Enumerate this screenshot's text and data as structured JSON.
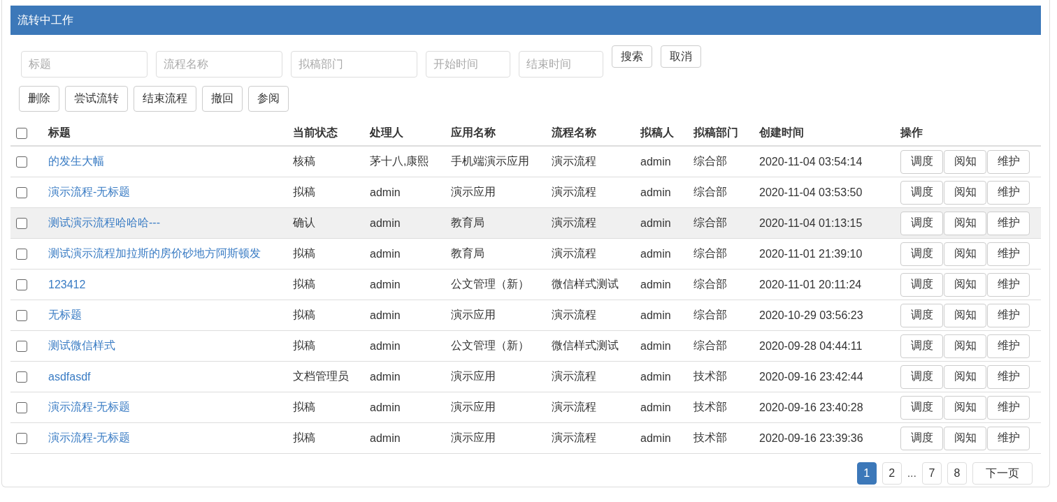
{
  "panel": {
    "title": "流转中工作"
  },
  "filters": [
    {
      "placeholder": "标题"
    },
    {
      "placeholder": "流程名称"
    },
    {
      "placeholder": "拟稿部门"
    },
    {
      "placeholder": "开始时间"
    },
    {
      "placeholder": "结束时间"
    }
  ],
  "filter_buttons": [
    "搜索",
    "取消"
  ],
  "toolbar_buttons": [
    "删除",
    "尝试流转",
    "结束流程",
    "撤回",
    "参阅"
  ],
  "table": {
    "select_all_checked": false,
    "columns": [
      "标题",
      "当前状态",
      "处理人",
      "应用名称",
      "流程名称",
      "拟稿人",
      "拟稿部门",
      "创建时间",
      "操作"
    ],
    "rows": [
      {
        "checked": false,
        "hovered": false,
        "title": "的发生大幅",
        "status": "核稿",
        "handler": "茅十八,康熙",
        "app": "手机端演示应用",
        "flow": "演示流程",
        "drafter": "admin",
        "dept": "综合部",
        "created": "2020-11-04 03:54:14",
        "actions": [
          "调度",
          "阅知",
          "维护"
        ]
      },
      {
        "checked": false,
        "hovered": false,
        "title": "演示流程-无标题",
        "status": "拟稿",
        "handler": "admin",
        "app": "演示应用",
        "flow": "演示流程",
        "drafter": "admin",
        "dept": "综合部",
        "created": "2020-11-04 03:53:50",
        "actions": [
          "调度",
          "阅知",
          "维护"
        ]
      },
      {
        "checked": false,
        "hovered": true,
        "title": "测试演示流程哈哈哈---",
        "status": "确认",
        "handler": "admin",
        "app": "教育局",
        "flow": "演示流程",
        "drafter": "admin",
        "dept": "综合部",
        "created": "2020-11-04 01:13:15",
        "actions": [
          "调度",
          "阅知",
          "维护"
        ]
      },
      {
        "checked": false,
        "hovered": false,
        "title": "测试演示流程加拉斯的房价砂地方阿斯顿发",
        "status": "拟稿",
        "handler": "admin",
        "app": "教育局",
        "flow": "演示流程",
        "drafter": "admin",
        "dept": "综合部",
        "created": "2020-11-01 21:39:10",
        "actions": [
          "调度",
          "阅知",
          "维护"
        ]
      },
      {
        "checked": false,
        "hovered": false,
        "title": "123412",
        "status": "拟稿",
        "handler": "admin",
        "app": "公文管理（新）",
        "flow": "微信样式测试",
        "drafter": "admin",
        "dept": "综合部",
        "created": "2020-11-01 20:11:24",
        "actions": [
          "调度",
          "阅知",
          "维护"
        ]
      },
      {
        "checked": false,
        "hovered": false,
        "title": "无标题",
        "status": "拟稿",
        "handler": "admin",
        "app": "演示应用",
        "flow": "演示流程",
        "drafter": "admin",
        "dept": "综合部",
        "created": "2020-10-29 03:56:23",
        "actions": [
          "调度",
          "阅知",
          "维护"
        ]
      },
      {
        "checked": false,
        "hovered": false,
        "title": "测试微信样式",
        "status": "拟稿",
        "handler": "admin",
        "app": "公文管理（新）",
        "flow": "微信样式测试",
        "drafter": "admin",
        "dept": "综合部",
        "created": "2020-09-28 04:44:11",
        "actions": [
          "调度",
          "阅知",
          "维护"
        ]
      },
      {
        "checked": false,
        "hovered": false,
        "title": "asdfasdf",
        "status": "文档管理员",
        "handler": "admin",
        "app": "演示应用",
        "flow": "演示流程",
        "drafter": "admin",
        "dept": "技术部",
        "created": "2020-09-16 23:42:44",
        "actions": [
          "调度",
          "阅知",
          "维护"
        ]
      },
      {
        "checked": false,
        "hovered": false,
        "title": "演示流程-无标题",
        "status": "拟稿",
        "handler": "admin",
        "app": "演示应用",
        "flow": "演示流程",
        "drafter": "admin",
        "dept": "技术部",
        "created": "2020-09-16 23:40:28",
        "actions": [
          "调度",
          "阅知",
          "维护"
        ]
      },
      {
        "checked": false,
        "hovered": false,
        "title": "演示流程-无标题",
        "status": "拟稿",
        "handler": "admin",
        "app": "演示应用",
        "flow": "演示流程",
        "drafter": "admin",
        "dept": "技术部",
        "created": "2020-09-16 23:39:36",
        "actions": [
          "调度",
          "阅知",
          "维护"
        ]
      }
    ]
  },
  "pagination": [
    {
      "kind": "page",
      "label": "1",
      "selected": true
    },
    {
      "kind": "page",
      "label": "2",
      "selected": false
    },
    {
      "kind": "ellipsis",
      "label": "..."
    },
    {
      "kind": "page",
      "label": "7",
      "selected": false
    },
    {
      "kind": "page",
      "label": "8",
      "selected": false
    },
    {
      "kind": "next",
      "label": "下一页",
      "selected": false
    }
  ]
}
